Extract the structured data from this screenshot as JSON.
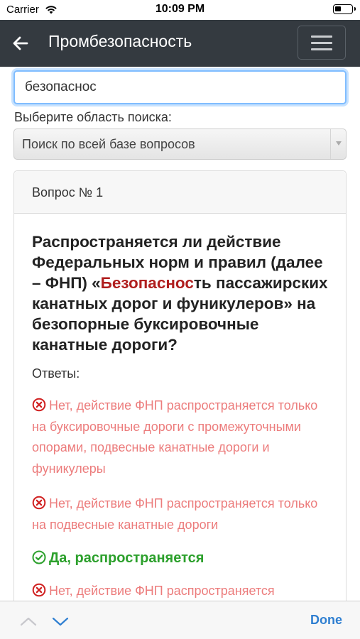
{
  "status_bar": {
    "carrier": "Carrier",
    "time": "10:09 PM",
    "wifi_icon": "wifi-icon",
    "battery_icon": "battery-icon"
  },
  "nav": {
    "back_icon": "arrow-left-icon",
    "title": "Промбезопасность",
    "menu_icon": "hamburger-menu-icon",
    "bg_color": "#343a40"
  },
  "search": {
    "value": "безопаснос",
    "placeholder": ""
  },
  "search_area": {
    "label": "Выберите область поиска:",
    "selected": "Поиск по всей базе вопросов"
  },
  "question_card": {
    "header": "Вопрос № 1",
    "text_before": "Распространяется ли действие Федеральных норм и правил (далее – ФНП) «",
    "highlight": "Безопаснос",
    "text_after": "ть пассажирских канатных дорог и фуникулеров» на безопорные буксировочные канатные дороги?",
    "highlight_color": "#b01e1e",
    "answers_label": "Ответы:",
    "answers": [
      {
        "text": "Нет, действие ФНП распространяется только на буксировочные дороги с промежуточными опорами, подвесные канатные дороги и фуникулеры",
        "correct": false,
        "icon": "x-circle-icon"
      },
      {
        "text": "Нет, действие ФНП распространяется только на подвесные канатные дороги",
        "correct": false,
        "icon": "x-circle-icon"
      },
      {
        "text": "Да, распространяется",
        "correct": true,
        "icon": "check-circle-icon"
      },
      {
        "text": "Нет, действие ФНП распространяется",
        "correct": false,
        "icon": "x-circle-icon"
      }
    ],
    "wrong_color": "#ec7c7c",
    "correct_color": "#2ca02c"
  },
  "toolbar": {
    "prev_icon": "chevron-up-icon",
    "next_icon": "chevron-down-icon",
    "done_label": "Done",
    "accent": "#2f7fd1"
  }
}
